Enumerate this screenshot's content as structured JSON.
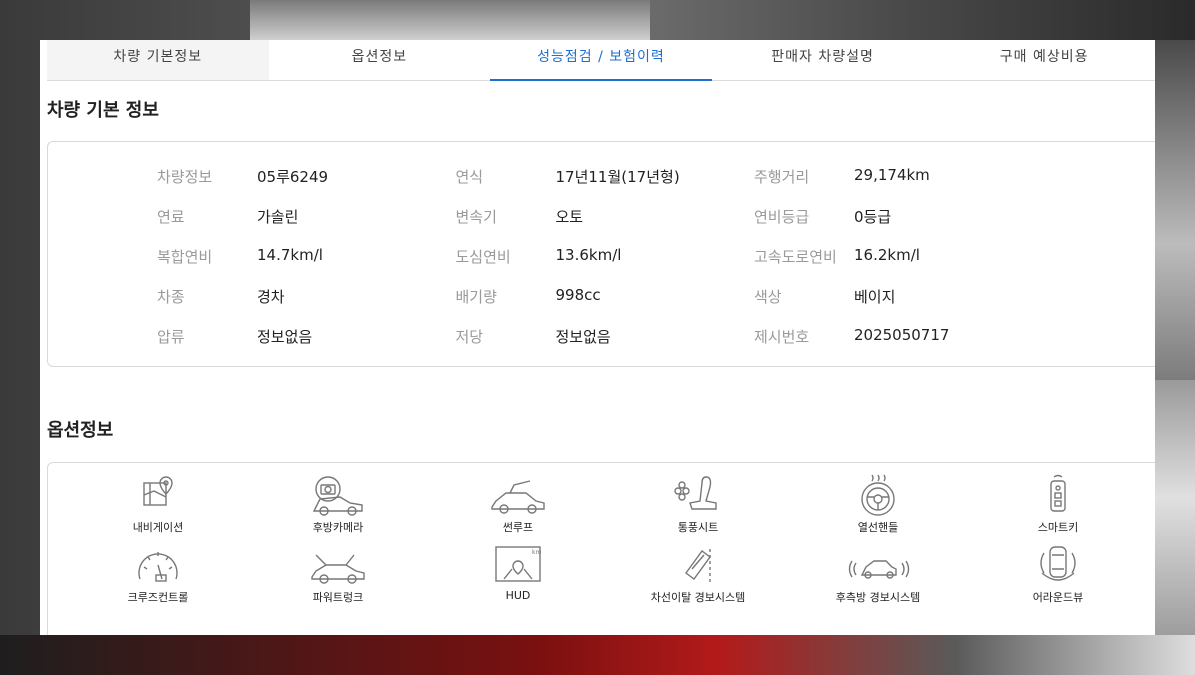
{
  "tabs": [
    {
      "label": "차량 기본정보"
    },
    {
      "label": "옵션정보"
    },
    {
      "label": "성능점검 / 보험이력"
    },
    {
      "label": "판매자 차량설명"
    },
    {
      "label": "구매 예상비용"
    }
  ],
  "basic_info": {
    "title": "차량 기본 정보",
    "rows": [
      [
        {
          "label": "차량정보",
          "value": "05루6249"
        },
        {
          "label": "연식",
          "value": "17년11월(17년형)"
        },
        {
          "label": "주행거리",
          "value": "29,174km"
        }
      ],
      [
        {
          "label": "연료",
          "value": "가솔린"
        },
        {
          "label": "변속기",
          "value": "오토"
        },
        {
          "label": "연비등급",
          "value": "0등급"
        }
      ],
      [
        {
          "label": "복합연비",
          "value": "14.7km/l"
        },
        {
          "label": "도심연비",
          "value": "13.6km/l"
        },
        {
          "label": "고속도로연비",
          "value": "16.2km/l"
        }
      ],
      [
        {
          "label": "차종",
          "value": "경차"
        },
        {
          "label": "배기량",
          "value": "998cc"
        },
        {
          "label": "색상",
          "value": "베이지"
        }
      ],
      [
        {
          "label": "압류",
          "value": "정보없음"
        },
        {
          "label": "저당",
          "value": "정보없음"
        },
        {
          "label": "제시번호",
          "value": "2025050717"
        }
      ]
    ]
  },
  "options": {
    "title": "옵션정보",
    "items": [
      {
        "label": "내비게이션",
        "icon": "navigation-icon"
      },
      {
        "label": "후방카메라",
        "icon": "rear-camera-icon"
      },
      {
        "label": "썬루프",
        "icon": "sunroof-icon"
      },
      {
        "label": "통풍시트",
        "icon": "ventilated-seat-icon"
      },
      {
        "label": "열선핸들",
        "icon": "heated-steering-icon"
      },
      {
        "label": "스마트키",
        "icon": "smart-key-icon"
      },
      {
        "label": "크루즈컨트롤",
        "icon": "cruise-control-icon"
      },
      {
        "label": "파워트렁크",
        "icon": "power-trunk-icon"
      },
      {
        "label": "HUD",
        "icon": "hud-icon"
      },
      {
        "label": "차선이탈 경보시스템",
        "icon": "lane-departure-icon"
      },
      {
        "label": "후측방 경보시스템",
        "icon": "blind-spot-icon"
      },
      {
        "label": "어라운드뷰",
        "icon": "around-view-icon"
      }
    ]
  },
  "colors": {
    "accent": "#1d6fd1",
    "label_gray": "#9a9a9a",
    "border": "#d9d9d9"
  }
}
